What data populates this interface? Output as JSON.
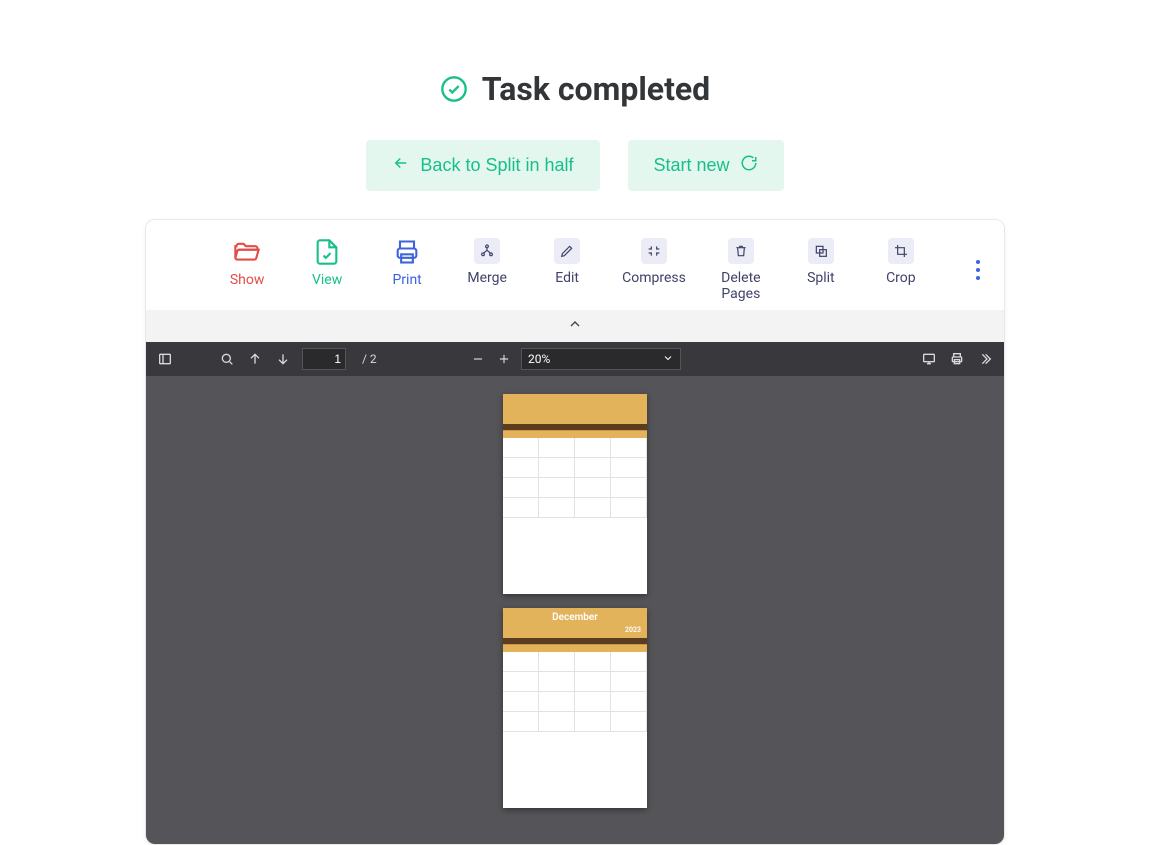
{
  "header": {
    "title": "Task completed"
  },
  "actions": {
    "back_label": "Back to Split in half",
    "start_new_label": "Start new"
  },
  "toolbar": {
    "show": "Show",
    "view": "View",
    "print": "Print",
    "merge": "Merge",
    "edit": "Edit",
    "compress": "Compress",
    "delete_pages": "Delete\nPages",
    "split": "Split",
    "crop": "Crop"
  },
  "pdfbar": {
    "page_current": "1",
    "page_total": "/ 2",
    "zoom_label": "20%"
  },
  "preview": {
    "page2_month": "December",
    "page2_year": "2023"
  }
}
